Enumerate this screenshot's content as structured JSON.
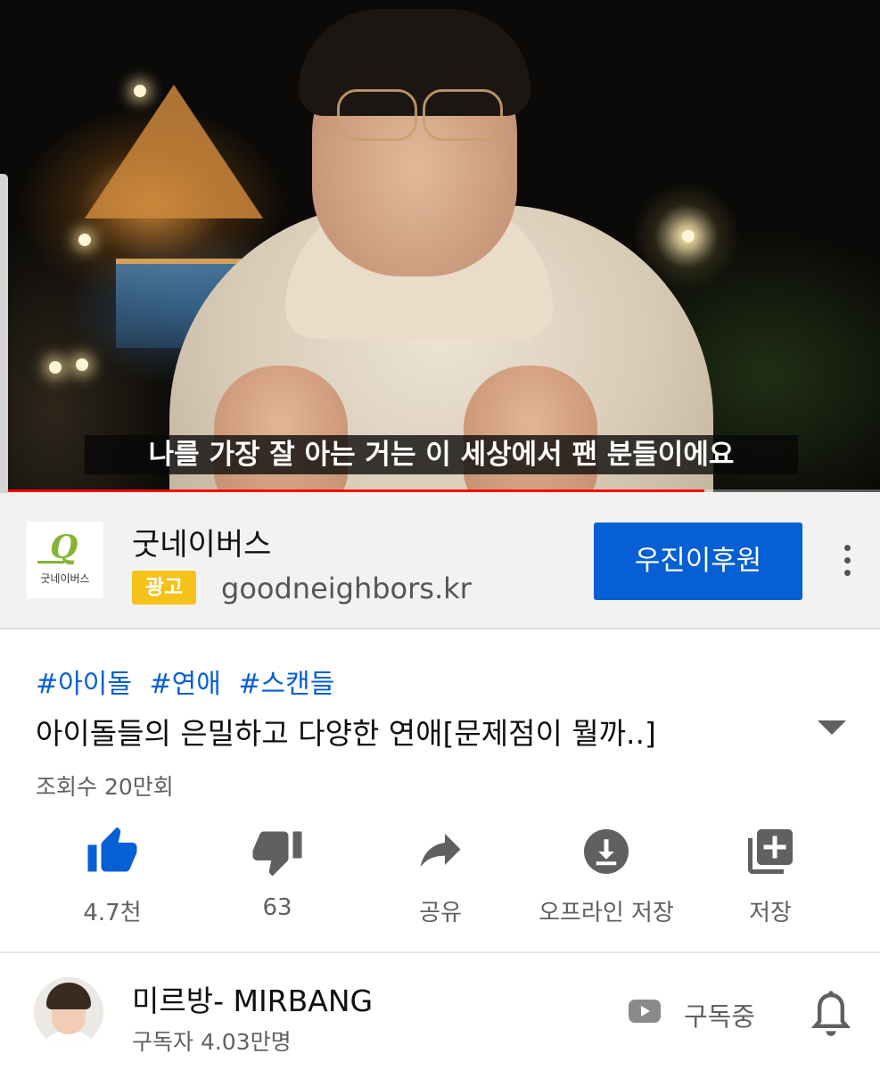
{
  "video": {
    "subtitle": "나를 가장 잘 아는 거는 이 세상에서 팬 분들이에요",
    "progress": 0.8
  },
  "ad": {
    "logo_text": "굿네이버스",
    "title": "굿네이버스",
    "badge": "광고",
    "url": "goodneighbors.kr",
    "cta": "우진이후원",
    "brand_color": "#86b534"
  },
  "meta": {
    "hashtags": [
      "#아이돌",
      "#연애",
      "#스캔들"
    ],
    "title": "아이돌들의 은밀하고 다양한 연애[문제점이 뭘까..]",
    "views": "조회수 20만회"
  },
  "actions": [
    {
      "icon": "thumb-up-icon",
      "label": "4.7천"
    },
    {
      "icon": "thumb-down-icon",
      "label": "63"
    },
    {
      "icon": "share-icon",
      "label": "공유"
    },
    {
      "icon": "download-icon",
      "label": "오프라인 저장"
    },
    {
      "icon": "playlist-add-icon",
      "label": "저장"
    }
  ],
  "channel": {
    "name": "미르방- MIRBANG",
    "subscribers": "구독자 4.03만명",
    "subscribe_label": "구독중"
  },
  "colors": {
    "accent_blue": "#065fd4",
    "progress_red": "#ff0000",
    "ad_badge": "#f6c21a"
  }
}
